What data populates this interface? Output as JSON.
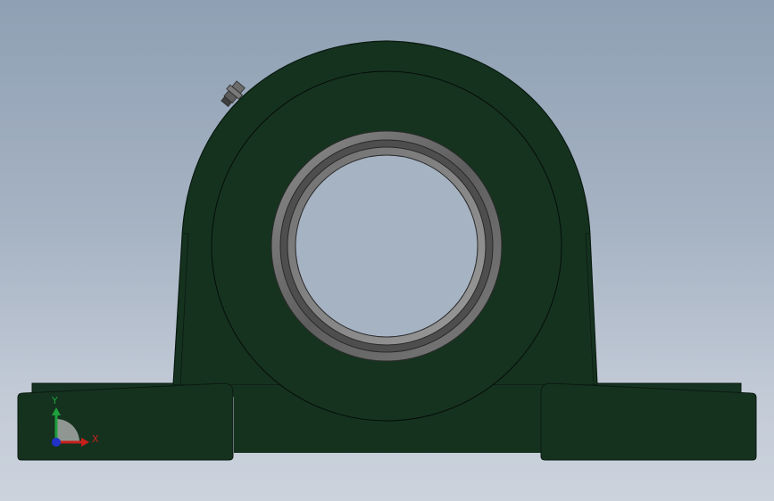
{
  "viewport": {
    "background_top": "#8fa0b4",
    "background_bottom": "#ccd3dd"
  },
  "part": {
    "body_color": "#15321f",
    "edge_color": "#0a1a10",
    "bore_ring_color": "#6d6d6d",
    "bore_inner_color": "#8a8a8a"
  },
  "triad": {
    "x_label": "X",
    "y_label": "Y",
    "x_color": "#c8201c",
    "y_color": "#1ea03c",
    "z_color": "#2032c8"
  }
}
